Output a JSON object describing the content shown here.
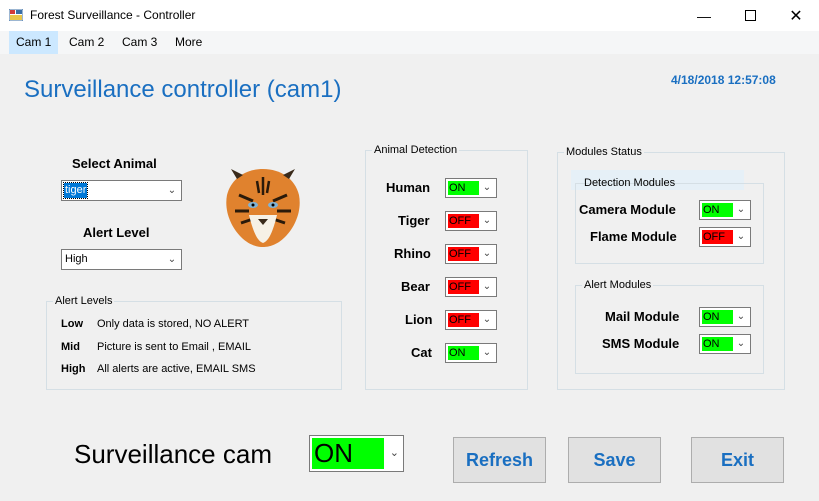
{
  "window": {
    "title": "Forest Surveillance - Controller"
  },
  "menu": {
    "items": [
      "Cam 1",
      "Cam 2",
      "Cam 3",
      "More"
    ]
  },
  "header": {
    "title": "Surveillance controller (cam1)",
    "datetime": "4/18/2018 12:57:08"
  },
  "animal": {
    "label": "Select Animal",
    "value": "tiger"
  },
  "alert": {
    "label": "Alert Level",
    "value": "High"
  },
  "alert_levels": {
    "title": "Alert Levels",
    "rows": [
      {
        "key": "Low",
        "text": "Only data is stored, NO ALERT"
      },
      {
        "key": "Mid",
        "text": "Picture is sent to Email , EMAIL"
      },
      {
        "key": "High",
        "text": "All alerts are active, EMAIL SMS"
      }
    ]
  },
  "detection": {
    "title": "Animal Detection",
    "items": [
      {
        "label": "Human",
        "state": "ON"
      },
      {
        "label": "Tiger",
        "state": "OFF"
      },
      {
        "label": "Rhino",
        "state": "OFF"
      },
      {
        "label": "Bear",
        "state": "OFF"
      },
      {
        "label": "Lion",
        "state": "OFF"
      },
      {
        "label": "Cat",
        "state": "ON"
      }
    ]
  },
  "modules": {
    "title": "Modules Status",
    "detection_title": "Detection Modules",
    "detection_items": [
      {
        "label": "Camera Module",
        "state": "ON"
      },
      {
        "label": "Flame Module",
        "state": "OFF"
      }
    ],
    "alert_title": "Alert Modules",
    "alert_items": [
      {
        "label": "Mail Module",
        "state": "ON"
      },
      {
        "label": "SMS Module",
        "state": "ON"
      }
    ]
  },
  "surveillance": {
    "label": "Surveillance cam",
    "state": "ON"
  },
  "buttons": {
    "refresh": "Refresh",
    "save": "Save",
    "exit": "Exit"
  },
  "colors": {
    "on": "#00ff00",
    "off": "#ff0000",
    "accent": "#1a6fc1"
  },
  "icons": {
    "app": "window-app-icon",
    "animal_image": "tiger-face-icon"
  }
}
